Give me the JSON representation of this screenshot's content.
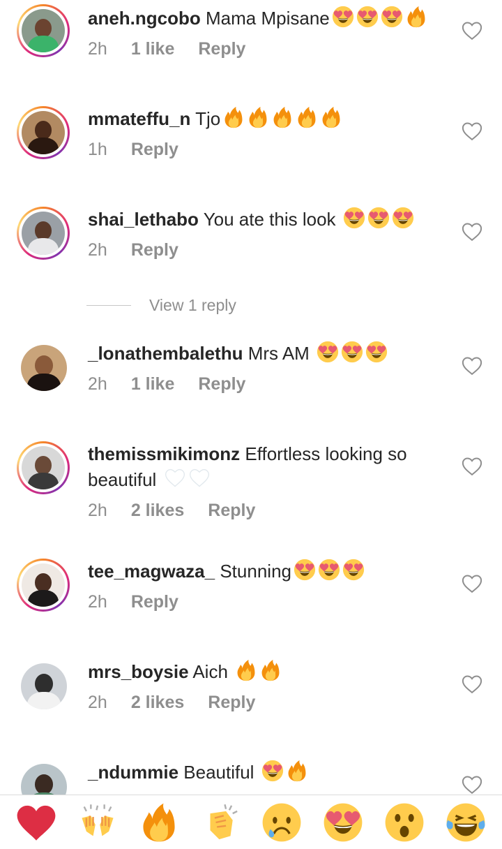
{
  "comments": [
    {
      "username": "aneh.ngcobo",
      "text": "Mama Mpisane",
      "emojis": [
        "heart-eyes",
        "heart-eyes",
        "heart-eyes",
        "fire"
      ],
      "time": "2h",
      "likes": "1 like",
      "reply": "Reply"
    },
    {
      "username": "mmateffu_n",
      "text": "Tjo",
      "emojis": [
        "fire",
        "fire",
        "fire",
        "fire",
        "fire"
      ],
      "time": "1h",
      "likes": "",
      "reply": "Reply"
    },
    {
      "username": "shai_lethabo",
      "text": "You ate this look ",
      "emojis": [
        "heart-eyes",
        "heart-eyes",
        "heart-eyes"
      ],
      "time": "2h",
      "likes": "",
      "reply": "Reply"
    },
    {
      "username": "_lonathembalethu",
      "text": "Mrs AM ",
      "emojis": [
        "heart-eyes",
        "heart-eyes",
        "heart-eyes"
      ],
      "time": "2h",
      "likes": "1 like",
      "reply": "Reply"
    },
    {
      "username": "themissmikimonz",
      "text": "Effortless looking so beautiful ",
      "emojis": [
        "white-heart",
        "white-heart"
      ],
      "time": "2h",
      "likes": "2 likes",
      "reply": "Reply"
    },
    {
      "username": "tee_magwaza_",
      "text": "Stunning",
      "emojis": [
        "heart-eyes",
        "heart-eyes",
        "heart-eyes"
      ],
      "time": "2h",
      "likes": "",
      "reply": "Reply"
    },
    {
      "username": "mrs_boysie",
      "text": "Aich ",
      "emojis": [
        "fire",
        "fire"
      ],
      "time": "2h",
      "likes": "2 likes",
      "reply": "Reply"
    },
    {
      "username": "_ndummie",
      "text": "Beautiful ",
      "emojis": [
        "heart-eyes",
        "fire"
      ],
      "time": "",
      "likes": "",
      "reply": ""
    }
  ],
  "view_replies": "View 1 reply",
  "reactions": [
    "red-heart",
    "raising-hands",
    "fire",
    "clapping-hands",
    "crying-face",
    "heart-eyes",
    "surprised-face",
    "tears-of-joy"
  ],
  "colors": {
    "username": "#262626",
    "meta": "#8e8e8e",
    "like_icon": "#8e8e8e"
  }
}
